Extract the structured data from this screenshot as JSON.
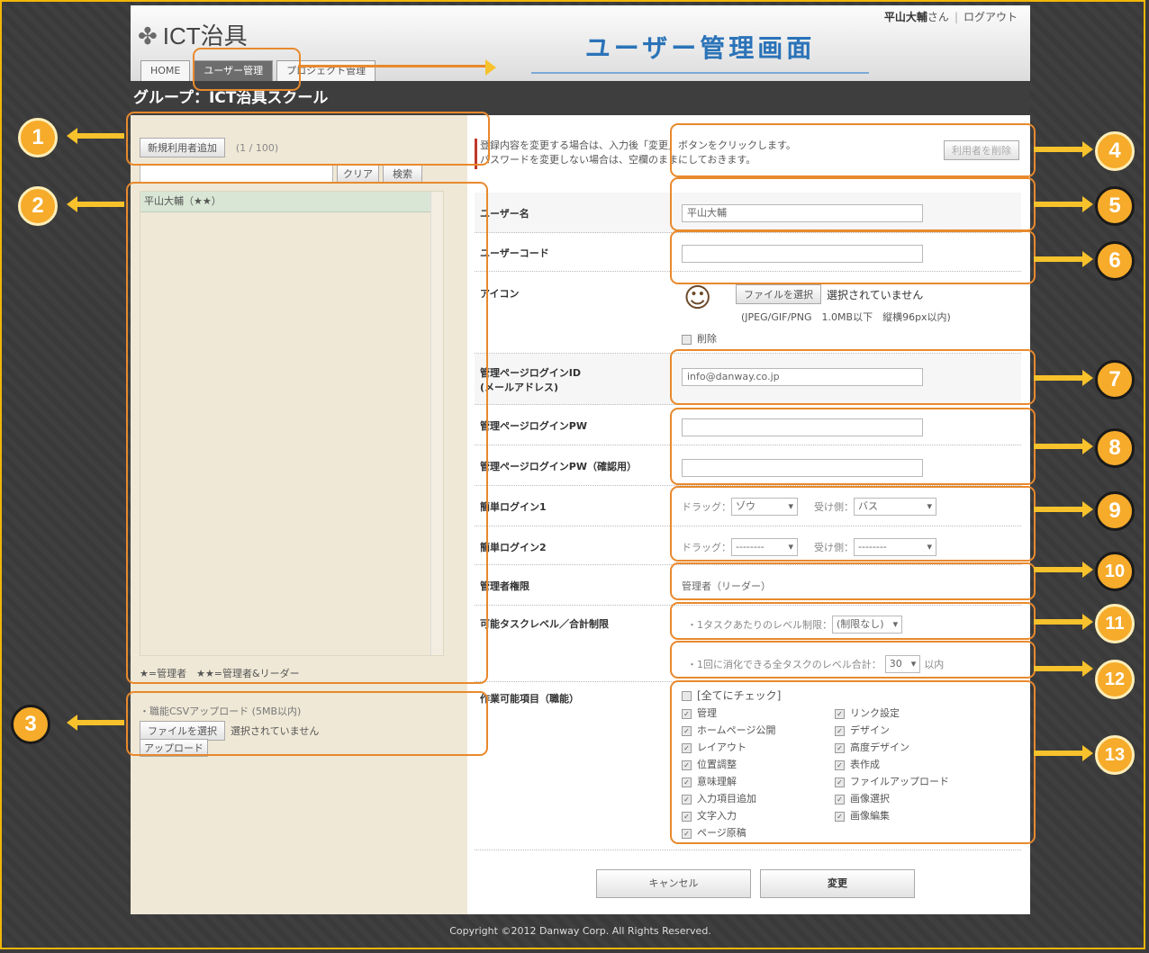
{
  "header": {
    "logo_text": "ICT治具",
    "user_name": "平山大輔",
    "user_suffix": "さん",
    "logout": "ログアウト",
    "screen_title": "ユーザー管理画面",
    "tabs": [
      {
        "label": "HOME",
        "active": false
      },
      {
        "label": "ユーザー管理",
        "active": true
      },
      {
        "label": "プロジェクト管理",
        "active": false
      }
    ]
  },
  "group_title": "グループ：ICT治具スクール",
  "sidebar": {
    "add_user_button": "新規利用者追加",
    "user_count": "(1 / 100)",
    "search_value": "",
    "clear_button": "クリア",
    "search_button": "検索",
    "users": [
      "平山大輔（★★）"
    ],
    "legend": "★=管理者　★★=管理者&リーダー",
    "csv_label": "・職能CSVアップロード (5MB以内)",
    "file_button": "ファイルを選択",
    "file_status": "選択されていません",
    "upload_button": "アップロード"
  },
  "form": {
    "notice_line1": "登録内容を変更する場合は、入力後「変更」ボタンをクリックします。",
    "notice_line2": "パスワードを変更しない場合は、空欄のままにしておきます。",
    "delete_user_button": "利用者を削除",
    "username_label": "ユーザー名",
    "username_value": "平山大輔",
    "usercode_label": "ユーザーコード",
    "usercode_value": "",
    "icon_label": "アイコン",
    "icon_file_button": "ファイルを選択",
    "icon_file_status": "選択されていません",
    "icon_note": "(JPEG/GIF/PNG　1.0MB以下　縦横96px以内)",
    "icon_delete_label": "削除",
    "login_id_label_1": "管理ページログインID",
    "login_id_label_2": "(メールアドレス)",
    "login_id_value": "info@danway.co.jp",
    "login_pw_label": "管理ページログインPW",
    "login_pw_confirm_label": "管理ページログインPW（確認用）",
    "easy_login1_label": "簡単ログイン1",
    "easy_login2_label": "簡単ログイン2",
    "drag_label": "ドラッグ：",
    "receiver_label": "受け側：",
    "easy1_drag": "ゾウ",
    "easy1_receiver": "バス",
    "easy2_drag": "--------",
    "easy2_receiver": "--------",
    "admin_role_label": "管理者権限",
    "admin_role_value": "管理者（リーダー）",
    "task_level_label": "可能タスクレベル／合計制限",
    "task_limit_text": "・1タスクあたりのレベル制限：",
    "task_limit_value": "(制限なし)",
    "task_total_text": "・1回に消化できる全タスクのレベル合計：",
    "task_total_value": "30",
    "task_total_suffix": "以内",
    "permissions_label": "作業可能項目（職能）",
    "check_all": "[全てにチェック]",
    "permissions_left": [
      "管理",
      "ホームページ公開",
      "レイアウト",
      "位置調整",
      "意味理解",
      "入力項目追加",
      "文字入力",
      "ページ原稿"
    ],
    "permissions_right": [
      "リンク設定",
      "デザイン",
      "高度デザイン",
      "表作成",
      "ファイルアップロード",
      "画像選択",
      "画像編集"
    ],
    "cancel_button": "キャンセル",
    "submit_button": "変更"
  },
  "footer": "Copyright ©2012 Danway Corp. All Rights Reserved.",
  "markers": [
    "1",
    "2",
    "3",
    "4",
    "5",
    "6",
    "7",
    "8",
    "9",
    "10",
    "11",
    "12",
    "13"
  ],
  "colors": {
    "accent": "#f6ab2a",
    "callout": "#e8892d",
    "title": "#2a73b8",
    "sidebar_bg": "#efe8d6"
  }
}
